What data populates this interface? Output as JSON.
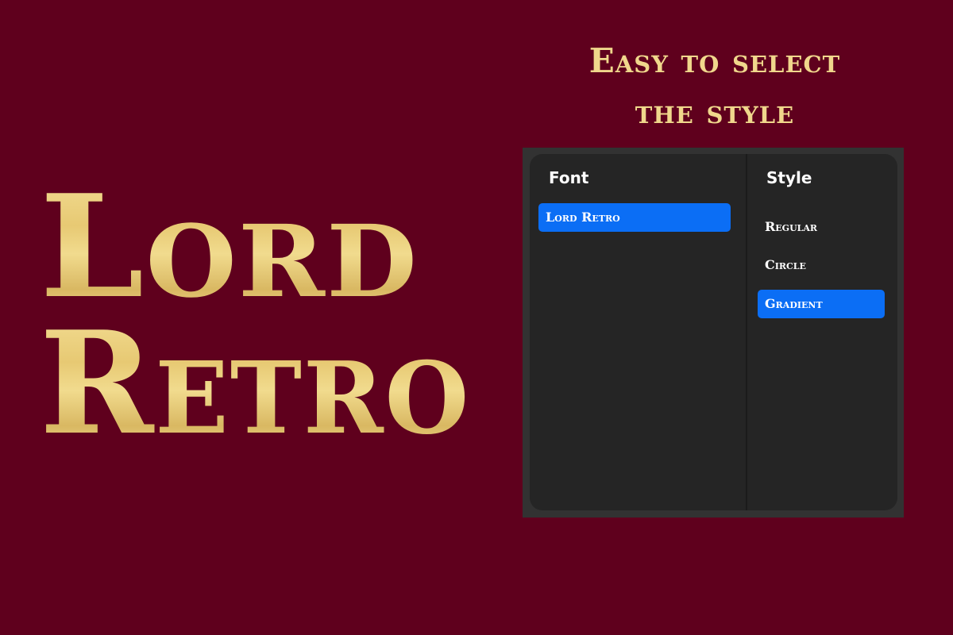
{
  "hero": {
    "line1": "Lord",
    "line2": "Retro"
  },
  "heading": {
    "line1": "Easy to select",
    "line2": "the style"
  },
  "picker": {
    "font_header": "Font",
    "style_header": "Style",
    "fonts": [
      {
        "label": "Lord Retro",
        "selected": true
      }
    ],
    "styles": [
      {
        "label": "Regular",
        "selected": false
      },
      {
        "label": "Circle",
        "selected": false
      },
      {
        "label": "Gradient",
        "selected": true
      }
    ],
    "accent_color": "#0b6ef5"
  },
  "colors": {
    "background": "#5f001d",
    "gold": "#f0d78c",
    "panel": "#252525"
  }
}
